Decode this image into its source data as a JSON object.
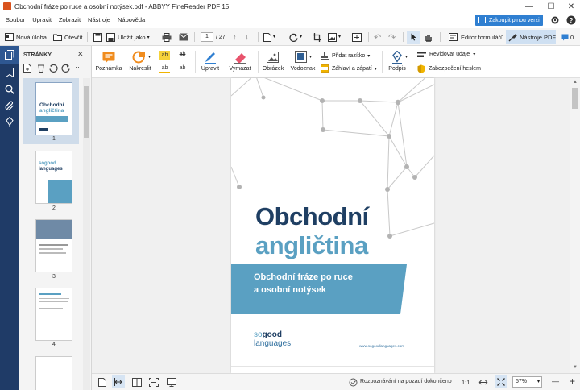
{
  "window": {
    "title": "Obchodní fráze po ruce a osobní notýsek.pdf - ABBYY FineReader PDF 15",
    "minimize": "—",
    "maximize": "☐",
    "close": "✕"
  },
  "menu": {
    "items": [
      "Soubor",
      "Upravit",
      "Zobrazit",
      "Nástroje",
      "Nápověda"
    ],
    "buy_label": "Zakoupit plnou verzi"
  },
  "toolbar": {
    "new_task": "Nová úloha",
    "open": "Otevřít",
    "save_as": "Uložit jako",
    "page_current": "1",
    "page_total": "/ 27",
    "form_editor": "Editor formulářů",
    "pdf_tools": "Nástroje PDF",
    "comments_count": "0"
  },
  "pages_panel": {
    "title": "STRÁNKY",
    "thumbnails": [
      {
        "number": "1",
        "title_line1": "Obchodní",
        "title_line2": "angličtina"
      },
      {
        "number": "2",
        "title_line1": "sogood",
        "title_line2": "languages"
      },
      {
        "number": "3"
      },
      {
        "number": "4"
      }
    ]
  },
  "ribbon": {
    "note": "Poznámka",
    "draw": "Nakreslit",
    "edit": "Upravit",
    "erase": "Vymazat",
    "image": "Obrázek",
    "watermark": "Vodoznak",
    "add_stamp": "Přidat razítko",
    "header_footer": "Záhlaví a zápatí",
    "signature": "Podpis",
    "redact": "Revidovat údaje",
    "password": "Zabezpečení heslem"
  },
  "document": {
    "title_line1": "Obchodní",
    "title_line2": "angličtina",
    "subtitle_line1": "Obchodní fráze po ruce",
    "subtitle_line2": "a osobní notýsek",
    "brand_line1_a": "so",
    "brand_line1_b": "good",
    "brand_line2": "languages",
    "url": "www.sogoodlanguages.com",
    "accent_color": "#5aa0c2",
    "title_color": "#1f3f63"
  },
  "status": {
    "recognition": "Rozpoznávání na pozadí dokončeno",
    "ratio": "1:1",
    "zoom": "57%",
    "zoom_out": "—",
    "zoom_in": "+"
  }
}
